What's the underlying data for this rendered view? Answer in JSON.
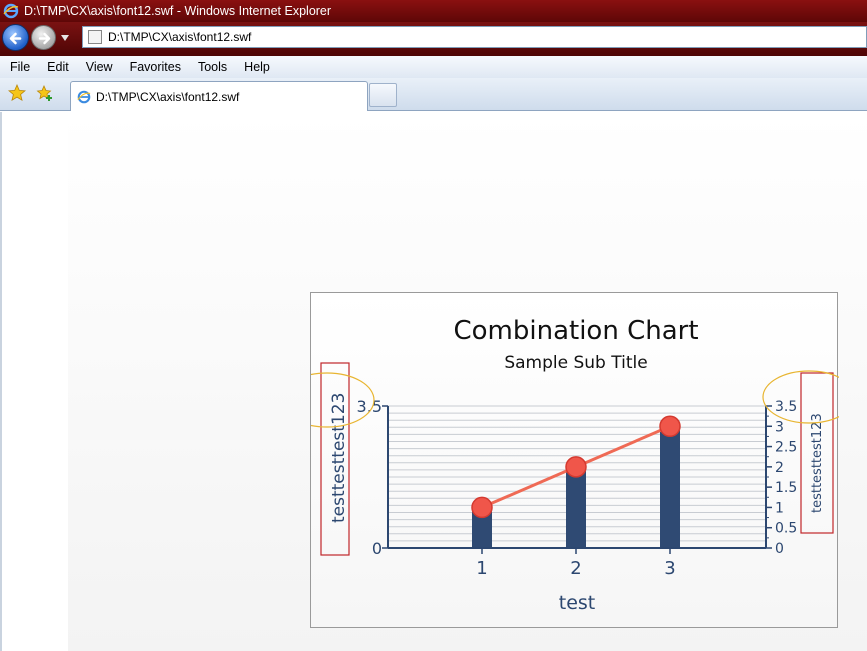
{
  "window": {
    "title": "D:\\TMP\\CX\\axis\\font12.swf - Windows Internet Explorer"
  },
  "address": {
    "url": "D:\\TMP\\CX\\axis\\font12.swf"
  },
  "menu": {
    "items": [
      "File",
      "Edit",
      "View",
      "Favorites",
      "Tools",
      "Help"
    ]
  },
  "tab": {
    "label": "D:\\TMP\\CX\\axis\\font12.swf"
  },
  "colors": {
    "bar": "#2f4a73",
    "line": "#ef6a55",
    "marker": "#f0564a",
    "axis": "#2c4770",
    "annotation_box": "#c0262a",
    "annotation_ellipse": "#e8b531"
  },
  "chart_data": {
    "type": "bar",
    "title": "Combination Chart",
    "subtitle": "Sample Sub Title",
    "xlabel": "test",
    "ylabel_left": "testtesttest123",
    "ylabel_right": "testtesttest123",
    "categories": [
      "1",
      "2",
      "3"
    ],
    "series": [
      {
        "type": "bar",
        "values": [
          1,
          2,
          3
        ]
      },
      {
        "type": "line",
        "values": [
          1,
          2,
          3
        ]
      }
    ],
    "left_axis": {
      "ylim": [
        0,
        3.5
      ],
      "ticks": [
        "0",
        "3.5"
      ]
    },
    "right_axis": {
      "ylim": [
        0,
        3.5
      ],
      "ticks": [
        "0",
        "0.5",
        "1",
        "1.5",
        "2",
        "2.5",
        "3",
        "3.5"
      ]
    },
    "grid": true
  }
}
